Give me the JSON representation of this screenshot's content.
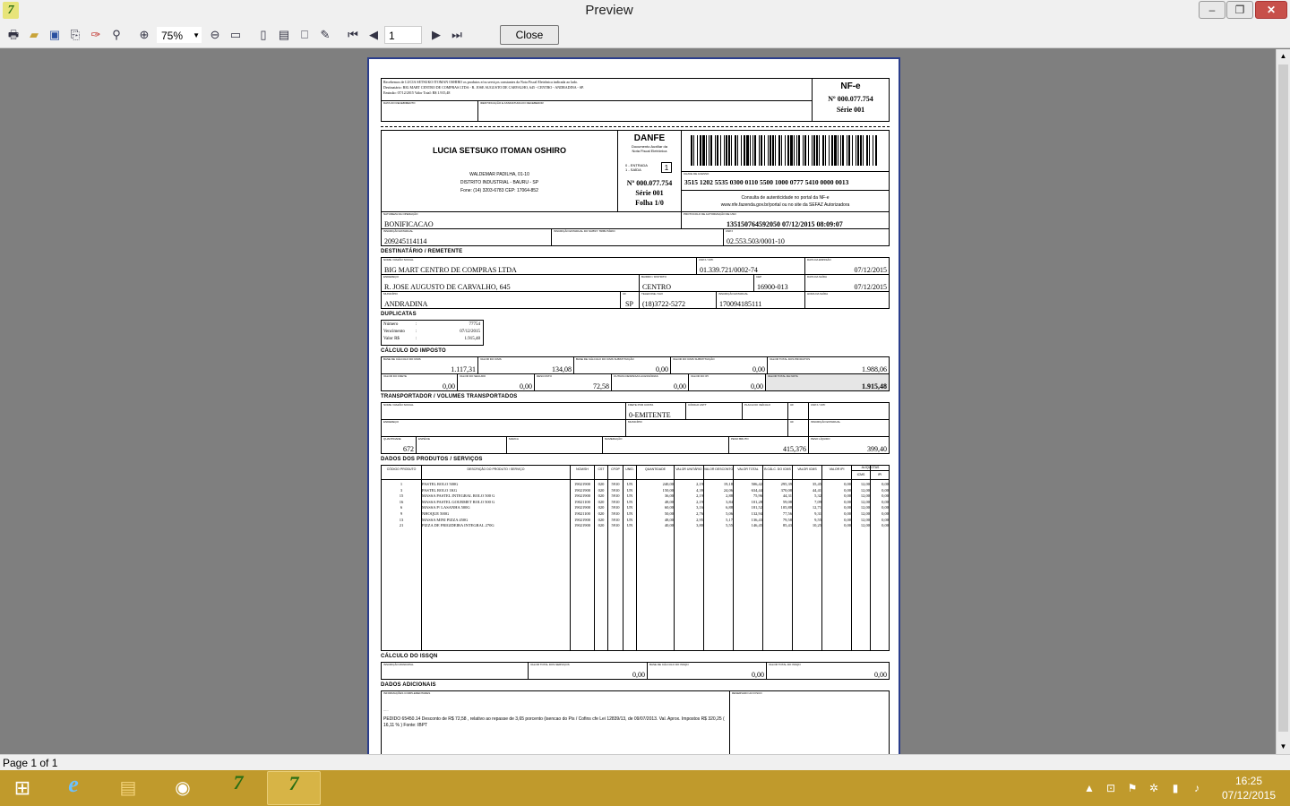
{
  "window": {
    "title": "Preview",
    "min": "–",
    "max": "❐",
    "close": "✕"
  },
  "toolbar": {
    "zoom": "75%",
    "page": "1",
    "close_label": "Close"
  },
  "status": {
    "page_label": "Page 1 of 1"
  },
  "clock": {
    "time": "16:25",
    "date": "07/12/2015"
  },
  "danfe": {
    "receipt": {
      "line1": "Recebemos de LUCIA SETSUKO ITOMAN OSHIRO os produtos e/ou serviços constantes da Nota Fiscal Eletrônica indicada ao lado.",
      "line2": "Destinatário: BIG MART CENTRO DE COMPRAS LTDA - R. JOSE AUGUSTO DE CARVALHO, 645 - CENTRO - ANDRADINA - SP.",
      "line3": "Emissão: 07/12/2015 Valor Total: R$ 1.915,48",
      "date_label": "DATA DO RECEBIMENTO",
      "sign_label": "IDENTIFICAÇÃO E ASSINATURA DO RECEBEDOR",
      "nfe": "NF-e",
      "number": "Nº 000.077.754",
      "serie": "Série 001"
    },
    "emitter": {
      "name": "LUCIA SETSUKO ITOMAN OSHIRO",
      "addr1": "WALDEMAR PADILHA, 01-10",
      "addr2": "DISTRITO INDUSTRIAL - BAURU - SP",
      "addr3": "Fone: (14) 3203-6783 CEP: 17064-852"
    },
    "box": {
      "title": "DANFE",
      "desc1": "Documento Auxiliar da",
      "desc2": "Nota Fiscal Eletrônica",
      "in_label": "0 - ENTRADA",
      "out_label": "1 - SAÍDA",
      "type": "1",
      "number": "Nº 000.077.754",
      "serie": "Série 001",
      "folha": "Folha 1/0"
    },
    "access_key": {
      "label": "CHAVE DE ACESSO",
      "value": "3515 1202 5535 0300 0110 5500 1000 0777 5410 0000 0013",
      "consult1": "Consulta de autenticidade no portal da NF-e",
      "consult2": "www.nfe.fazenda.gov.br/portal ou no site da SEFAZ Autorizadora"
    },
    "natureza": {
      "label": "NATUREZA DA OPERAÇÃO",
      "value": "BONIFICACAO"
    },
    "protocolo": {
      "label": "PROTOCOLO DE AUTORIZAÇÃO DE USO",
      "value": "135150764592050 07/12/2015 08:09:07"
    },
    "ie": {
      "label": "INSCRIÇÃO ESTADUAL",
      "value": "209245114114"
    },
    "ie_st": {
      "label": "INSCRIÇÃO ESTADUAL DO SUBST. TRIBUTÁRIO",
      "value": ""
    },
    "cnpj": {
      "label": "CNPJ",
      "value": "02.553.503/0001-10"
    },
    "dest": {
      "section": "DESTINATÁRIO / REMETENTE",
      "name_label": "NOME / RAZÃO SOCIAL",
      "name": "BIG MART CENTRO DE COMPRAS LTDA",
      "cnpj_label": "CNPJ / CPF",
      "cnpj": "01.339.721/0002-74",
      "emissao_label": "DATA DA EMISSÃO",
      "emissao": "07/12/2015",
      "end_label": "ENDEREÇO",
      "end": "R. JOSE AUGUSTO DE CARVALHO, 645",
      "bairro_label": "BAIRRO / DISTRITO",
      "bairro": "CENTRO",
      "cep_label": "CEP",
      "cep": "16900-013",
      "saida_label": "DATA DA SAÍDA",
      "saida": "07/12/2015",
      "mun_label": "MUNICÍPIO",
      "mun": "ANDRADINA",
      "uf_label": "UF",
      "uf": "SP",
      "fone_label": "TELEFONE / FAX",
      "fone": "(18)3722-5272",
      "ie_label": "INSCRIÇÃO ESTADUAL",
      "ie": "170094185111",
      "hora_label": "HORA DA SAÍDA",
      "hora": ""
    },
    "dup": {
      "section": "DUPLICATAS",
      "num_label": "Número",
      "num": "77754",
      "venc_label": "Vencimento",
      "venc": "07/12/2015",
      "valor_label": "Valor R$",
      "valor": "1.915,48",
      "sep": ":"
    },
    "imposto": {
      "section": "CÁLCULO DO IMPOSTO",
      "cells": [
        {
          "label": "BASE DE CÁLCULO DO ICMS",
          "value": "1.117,31"
        },
        {
          "label": "VALOR DO ICMS",
          "value": "134,08"
        },
        {
          "label": "BASE DE CÁLCULO DO ICMS SUBSTITUIÇÃO",
          "value": "0,00"
        },
        {
          "label": "VALOR DO ICMS SUBSTITUIÇÃO",
          "value": "0,00"
        },
        {
          "label": "VALOR TOTAL DOS PRODUTOS",
          "value": "1.988,06"
        },
        {
          "label": "VALOR DO FRETE",
          "value": "0,00"
        },
        {
          "label": "VALOR DO SEGURO",
          "value": "0,00"
        },
        {
          "label": "DESCONTO",
          "value": "72,58"
        },
        {
          "label": "OUTRAS DESPESAS ACESSÓRIAS",
          "value": "0,00"
        },
        {
          "label": "VALOR DO IPI",
          "value": "0,00"
        },
        {
          "label": "VALOR TOTAL DA NOTA",
          "value": "1.915,48"
        }
      ]
    },
    "transp": {
      "section": "TRANSPORTADOR / VOLUMES TRANSPORTADOS",
      "name_label": "NOME / RAZÃO SOCIAL",
      "frete_label": "FRETE POR CONTA",
      "frete": "0-EMITENTE",
      "antt_label": "CÓDIGO ANTT",
      "placa_label": "PLACA DO VEÍCULO",
      "uf_label": "UF",
      "cnpj_label": "CNPJ / CPF",
      "end_label": "ENDEREÇO",
      "mun_label": "MUNICÍPIO",
      "uf2_label": "UF",
      "ie_label": "INSCRIÇÃO ESTADUAL",
      "qtd_label": "QUANTIDADE",
      "qtd": "672",
      "esp_label": "ESPÉCIE",
      "marca_label": "MARCA",
      "numer_label": "NUMERAÇÃO",
      "pb_label": "PESO BRUTO",
      "pb": "415,376",
      "pl_label": "PESO LÍQUIDO",
      "pl": "399,40"
    },
    "prod": {
      "section": "DADOS DOS PRODUTOS / SERVIÇOS",
      "headers": [
        "CÓDIGO PRODUTO",
        "DESCRIÇÃO DO PRODUTO / SERVIÇO",
        "NCM/SH",
        "CST",
        "CFOP",
        "UNID.",
        "QUANTIDADE",
        "VALOR UNITÁRIO",
        "VALOR DESCONTO",
        "VALOR TOTAL",
        "B.CÁLC. DO ICMS",
        "VALOR ICMS",
        "VALOR IPI",
        "ALÍQUOTAS",
        "ICMS",
        "IPI"
      ],
      "rows": [
        [
          "1",
          "PASTEL ROLO 500G",
          "19021900",
          "020",
          "5910",
          "UN",
          "240,00",
          "2,19",
          "19,18",
          "506,42",
          "295,39",
          "35,45",
          "0,00",
          "12,00",
          "0,00"
        ],
        [
          "3",
          "PASTEL ROLO 1KG",
          "19021900",
          "020",
          "5910",
          "UN",
          "150,00",
          "4,39",
          "24,06",
          "634,44",
          "370,08",
          "44,41",
          "0,00",
          "12,00",
          "0,00"
        ],
        [
          "15",
          "MASSA PASTEL INTEGRAL ROLO 500 G",
          "19021900",
          "020",
          "5910",
          "UN",
          "36,00",
          "2,19",
          "2,88",
          "75,96",
          "44,31",
          "5,32",
          "0,00",
          "12,00",
          "0,00"
        ],
        [
          "16",
          "MASSA PASTEL GOURMET ROLO 500 G",
          "19021100",
          "020",
          "5910",
          "UN",
          "48,00",
          "2,19",
          "3,84",
          "101,28",
          "59,08",
          "7,09",
          "0,00",
          "12,00",
          "0,00"
        ],
        [
          "6",
          "MASSA P/ LASANHA 500G",
          "19021900",
          "020",
          "5910",
          "UN",
          "60,00",
          "3,16",
          "6,88",
          "181,52",
          "105,88",
          "12,71",
          "0,00",
          "12,00",
          "0,00"
        ],
        [
          "9",
          "NHOQUE 500G",
          "19021100",
          "020",
          "5910",
          "UN",
          "50,00",
          "2,76",
          "5,06",
          "132,94",
          "77,56",
          "9,31",
          "0,00",
          "12,00",
          "0,00"
        ],
        [
          "13",
          "MASSA MINI PIZZA 450G",
          "19021900",
          "020",
          "5910",
          "UN",
          "48,00",
          "2,95",
          "5,17",
          "136,43",
          "79,58",
          "9,55",
          "0,00",
          "12,00",
          "0,00"
        ],
        [
          "21",
          "PIZZA DE FRIGIDEIRA INTEGRAL 270G",
          "19021900",
          "020",
          "5910",
          "UN",
          "40,00",
          "3,80",
          "5,55",
          "146,45",
          "85,43",
          "10,25",
          "0,00",
          "12,00",
          "0,00"
        ]
      ]
    },
    "issqn": {
      "section": "CÁLCULO DO ISSQN",
      "cells": [
        {
          "label": "INSCRIÇÃO MUNICIPAL",
          "value": ""
        },
        {
          "label": "VALOR TOTAL DOS SERVIÇOS",
          "value": "0,00"
        },
        {
          "label": "BASE DE CÁLCULO DO ISSQN",
          "value": "0,00"
        },
        {
          "label": "VALOR TOTAL DO ISSQN",
          "value": "0,00"
        }
      ]
    },
    "adic": {
      "section": "DADOS ADICIONAIS",
      "info_label": "INFORMAÇÕES COMPLEMENTARES",
      "info_dots": ".....",
      "info_text": "PEDIDO 65450.14 Desconto de R$ 72,58 , relativo ao repasse de 3,65 porcento (isencao do Pis / Cofins cfe Lei 12839/13, de 09/07/2013. Val. Aprox. Impostos R$ 320,25 ( 16,11 % ) Fonte: IBPT",
      "fisco_label": "RESERVADO AO FISCO"
    }
  }
}
